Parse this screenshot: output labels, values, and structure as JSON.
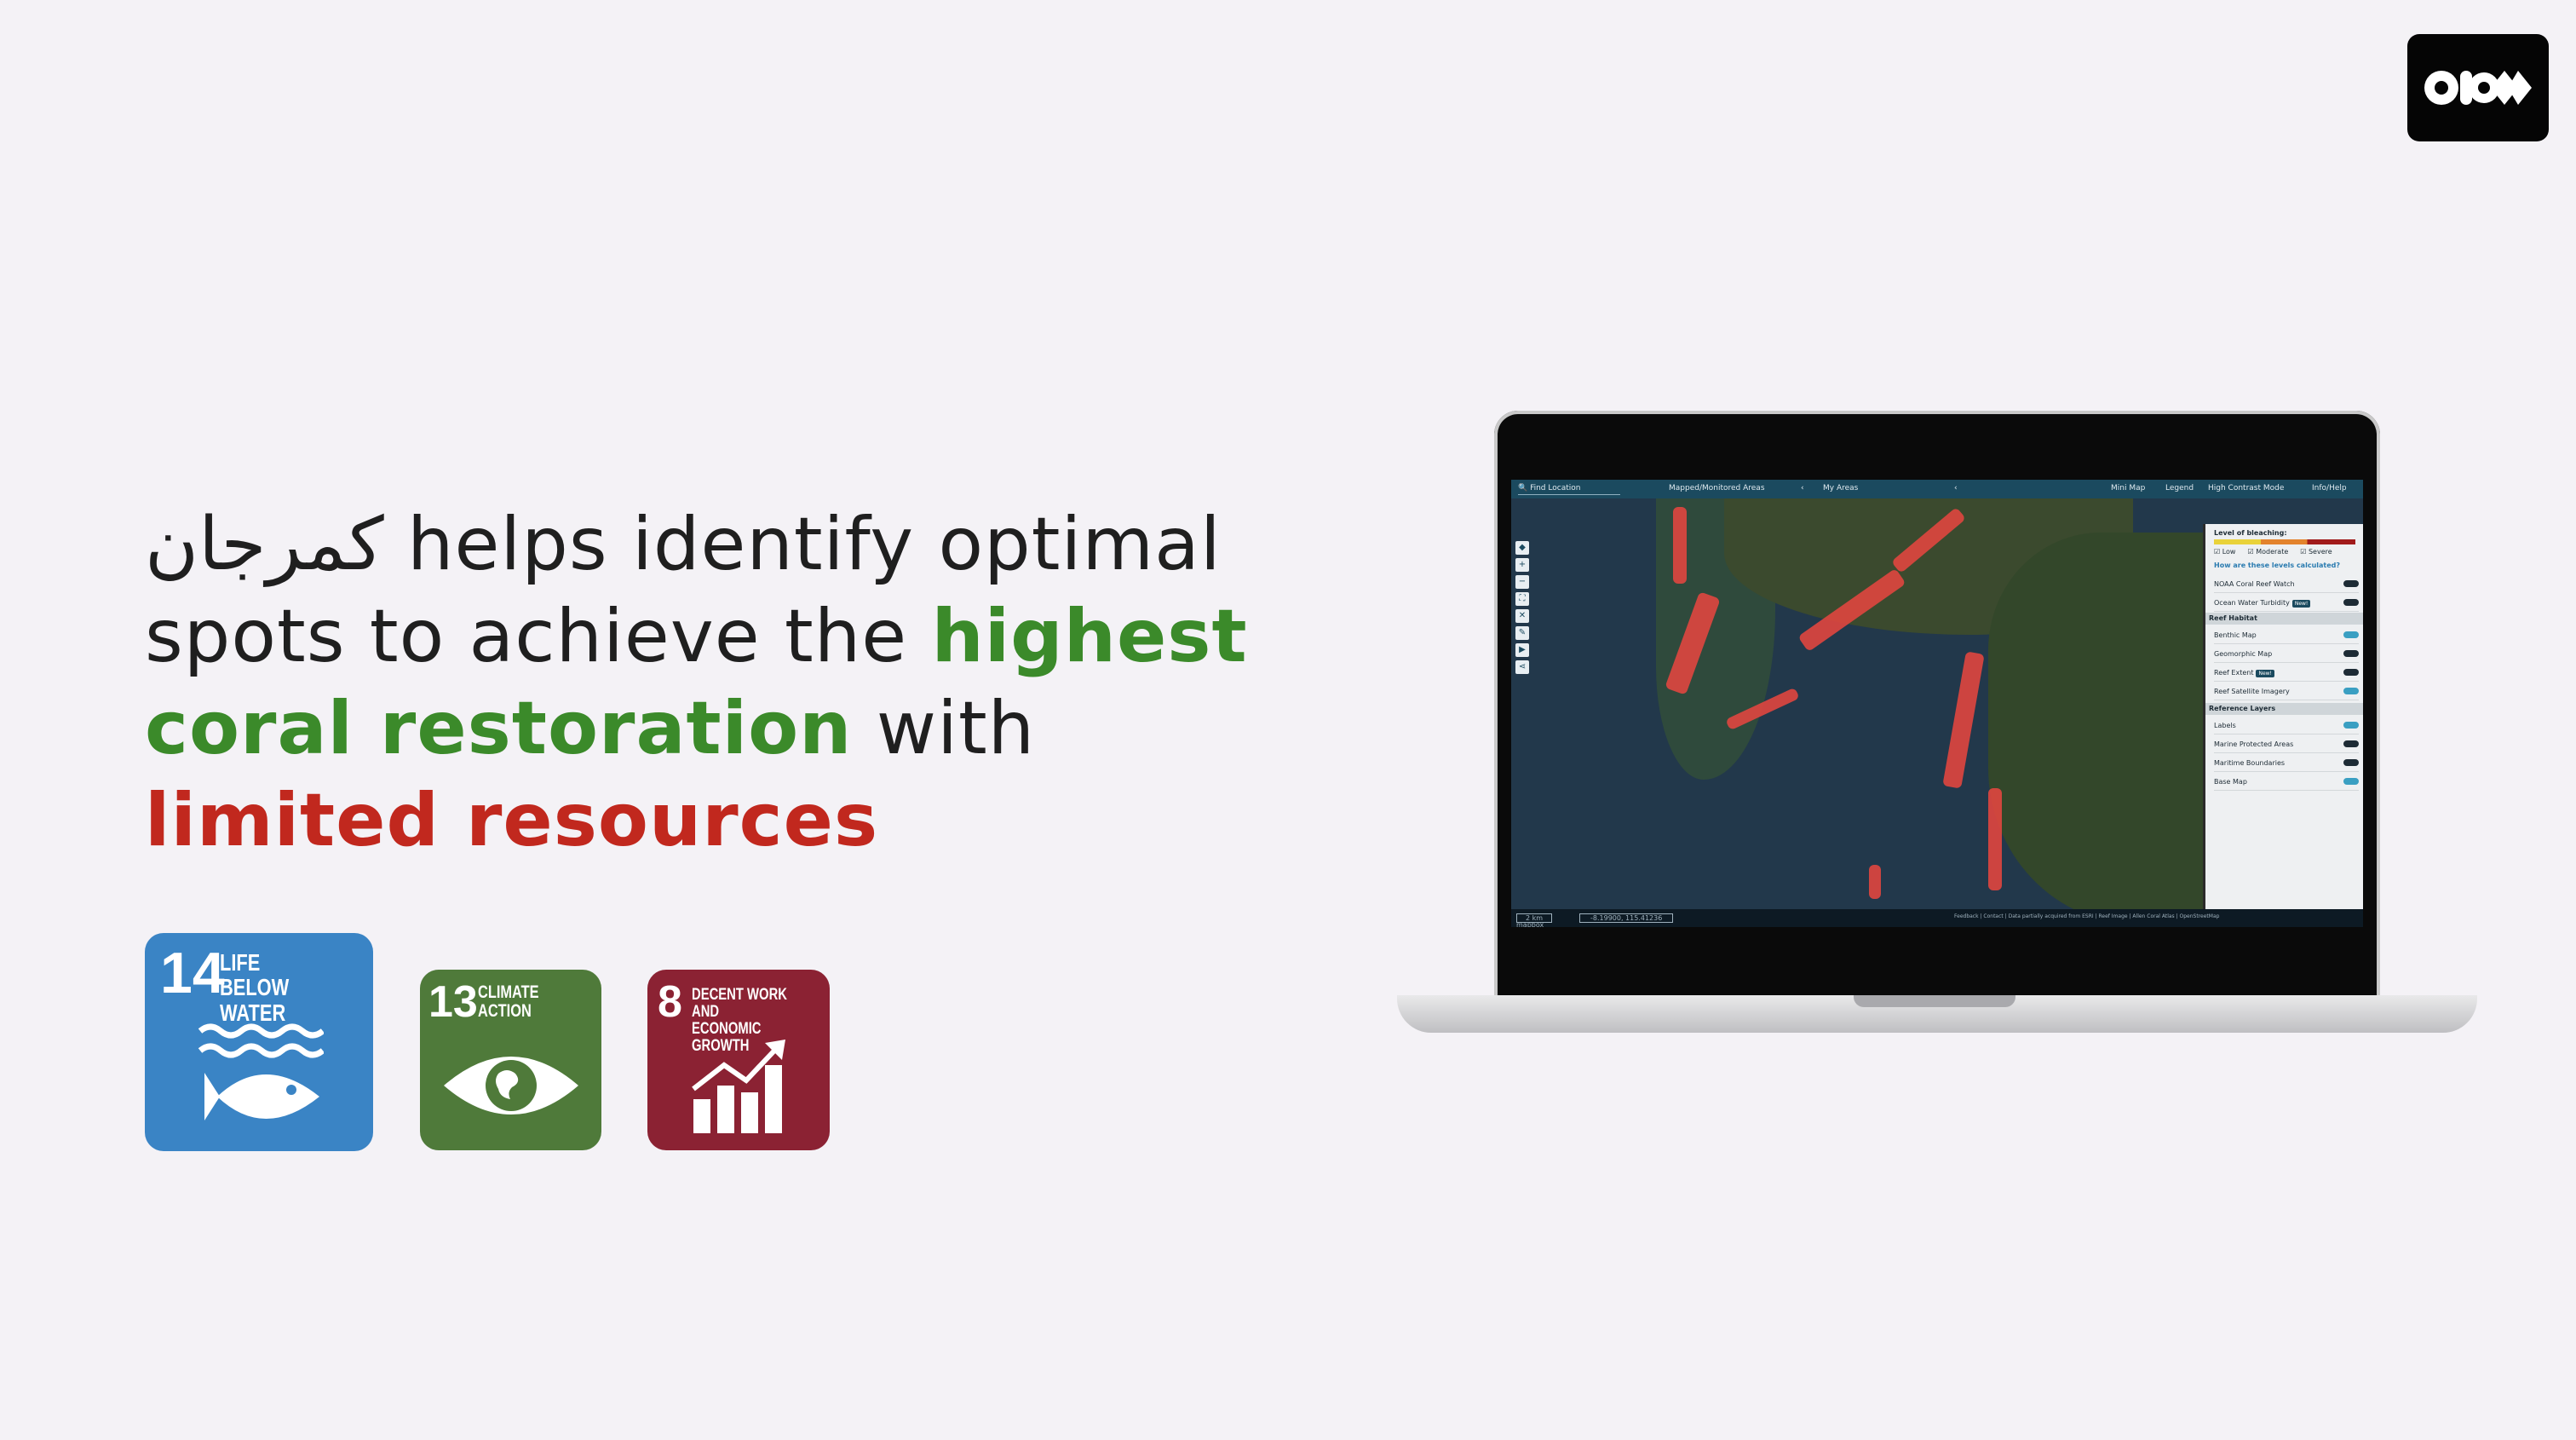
{
  "headline": {
    "arabic_name": "كمرجان",
    "part1": " helps identify optimal spots to achieve the ",
    "highlight_green": "highest coral restoration",
    "part2": " with ",
    "highlight_red": "limited resources"
  },
  "sdgs": [
    {
      "number": "14",
      "line1": "LIFE",
      "line2": "BELOW WATER",
      "color": "#3a84c5"
    },
    {
      "number": "13",
      "line1": "CLIMATE",
      "line2": "ACTION",
      "color": "#4f7a3a"
    },
    {
      "number": "8",
      "line1": "DECENT WORK AND",
      "line2": "ECONOMIC GROWTH",
      "color": "#8b2233"
    }
  ],
  "app": {
    "topbar": {
      "search_placeholder": "Find Location",
      "tab_mapped": "Mapped/Monitored Areas",
      "tab_my_areas": "My Areas",
      "mini_map": "Mini Map",
      "legend": "Legend",
      "high_contrast": "High Contrast Mode",
      "info_help": "Info/Help"
    },
    "panel": {
      "bleaching_title": "Level of bleaching:",
      "levels": [
        "Low",
        "Moderate",
        "Severe"
      ],
      "levels_link": "How are these levels calculated?",
      "layers_top": [
        {
          "label": "NOAA Coral Reef Watch",
          "on": false
        },
        {
          "label": "Ocean Water Turbidity",
          "badge": "New!",
          "on": false
        }
      ],
      "reef_habitat_title": "Reef Habitat",
      "reef_habitat": [
        {
          "label": "Benthic Map",
          "on": true
        },
        {
          "label": "Geomorphic Map",
          "on": false
        },
        {
          "label": "Reef Extent",
          "badge": "New!",
          "on": false
        },
        {
          "label": "Reef Satellite Imagery",
          "on": true
        }
      ],
      "reference_title": "Reference Layers",
      "reference": [
        {
          "label": "Labels",
          "on": true
        },
        {
          "label": "Marine Protected Areas",
          "on": false
        },
        {
          "label": "Maritime Boundaries",
          "on": false
        },
        {
          "label": "Base Map",
          "on": true
        }
      ]
    },
    "bottombar": {
      "scale": "2 km",
      "coords": "-8.19900, 115.41236",
      "brand": "mapbox",
      "attribution": "Feedback | Contact | Data partially acquired from ESRI | Reef Image | Allen Coral Atlas | OpenStreetMap"
    }
  }
}
